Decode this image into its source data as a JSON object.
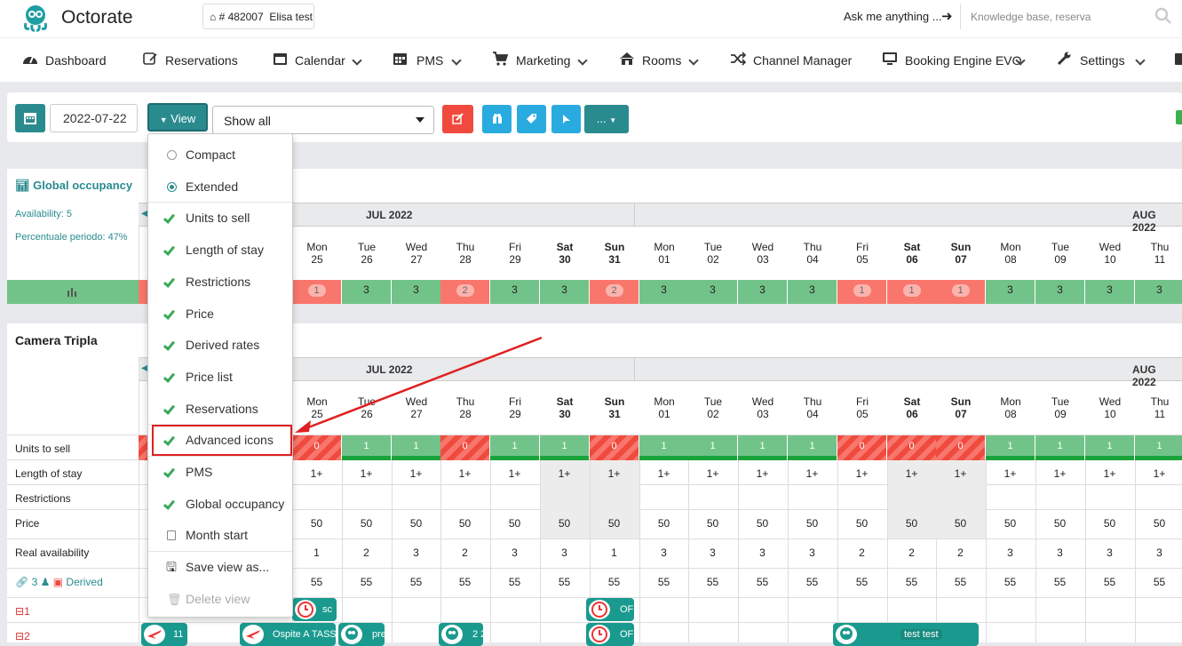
{
  "header": {
    "app_name": "Octorate",
    "property_id": "# 482007",
    "property_name": "Elisa test",
    "ask_label": "Ask me anything ...",
    "search_placeholder": "Knowledge base, reserva"
  },
  "nav": [
    {
      "label": "Dashboard",
      "icon": "dashboard-icon"
    },
    {
      "label": "Reservations",
      "icon": "reservations-icon"
    },
    {
      "label": "Calendar",
      "icon": "calendar-icon",
      "dropdown": true
    },
    {
      "label": "PMS",
      "icon": "pms-icon",
      "dropdown": true
    },
    {
      "label": "Marketing",
      "icon": "cart-icon",
      "dropdown": true
    },
    {
      "label": "Rooms",
      "icon": "home-icon",
      "dropdown": true
    },
    {
      "label": "Channel Manager",
      "icon": "shuffle-icon"
    },
    {
      "label": "Booking Engine EVO",
      "icon": "monitor-icon",
      "dropdown": true
    },
    {
      "label": "Settings",
      "icon": "wrench-icon",
      "dropdown": true
    }
  ],
  "toolbar": {
    "date": "2022-07-22",
    "view_label": "View",
    "filter_value": "Show all",
    "more_label": "..."
  },
  "view_menu": [
    {
      "label": "Compact",
      "type": "radio",
      "checked": false
    },
    {
      "label": "Extended",
      "type": "radio",
      "checked": true
    },
    {
      "label": "Units to sell",
      "type": "check",
      "checked": true
    },
    {
      "label": "Length of stay",
      "type": "check",
      "checked": true
    },
    {
      "label": "Restrictions",
      "type": "check",
      "checked": true
    },
    {
      "label": "Price",
      "type": "check",
      "checked": true
    },
    {
      "label": "Derived rates",
      "type": "check",
      "checked": true
    },
    {
      "label": "Price list",
      "type": "check",
      "checked": true
    },
    {
      "label": "Reservations",
      "type": "check",
      "checked": true
    },
    {
      "label": "Advanced icons",
      "type": "check",
      "checked": true,
      "highlighted": true
    },
    {
      "label": "PMS",
      "type": "check",
      "checked": true
    },
    {
      "label": "Global occupancy",
      "type": "check",
      "checked": true
    },
    {
      "label": "Month start",
      "type": "box",
      "checked": false
    },
    {
      "label": "Save view as...",
      "type": "save"
    },
    {
      "label": "Delete view",
      "type": "trash",
      "disabled": true
    }
  ],
  "global": {
    "title": "Global occupancy",
    "availability": "Availability: 5",
    "percent": "Percentuale periodo: 47%"
  },
  "months": {
    "jul": "JUL 2022",
    "aug": "AUG 2022"
  },
  "days": [
    {
      "dow": "Mon",
      "num": "25",
      "we": false
    },
    {
      "dow": "Tue",
      "num": "26",
      "we": false
    },
    {
      "dow": "Wed",
      "num": "27",
      "we": false
    },
    {
      "dow": "Thu",
      "num": "28",
      "we": false
    },
    {
      "dow": "Fri",
      "num": "29",
      "we": false
    },
    {
      "dow": "Sat",
      "num": "30",
      "we": true
    },
    {
      "dow": "Sun",
      "num": "31",
      "we": true
    },
    {
      "dow": "Mon",
      "num": "01",
      "we": false
    },
    {
      "dow": "Tue",
      "num": "02",
      "we": false
    },
    {
      "dow": "Wed",
      "num": "03",
      "we": false
    },
    {
      "dow": "Thu",
      "num": "04",
      "we": false
    },
    {
      "dow": "Fri",
      "num": "05",
      "we": false
    },
    {
      "dow": "Sat",
      "num": "06",
      "we": true
    },
    {
      "dow": "Sun",
      "num": "07",
      "we": true
    },
    {
      "dow": "Mon",
      "num": "08",
      "we": false
    },
    {
      "dow": "Tue",
      "num": "09",
      "we": false
    },
    {
      "dow": "Wed",
      "num": "10",
      "we": false
    },
    {
      "dow": "Thu",
      "num": "11",
      "we": false
    }
  ],
  "occupancy": [
    "1",
    "3",
    "3",
    "2",
    "3",
    "3",
    "2",
    "3",
    "3",
    "3",
    "3",
    "1",
    "1",
    "1",
    "3",
    "3",
    "3",
    "3"
  ],
  "occupancy_low": [
    true,
    false,
    false,
    true,
    false,
    false,
    true,
    false,
    false,
    false,
    false,
    true,
    true,
    true,
    false,
    false,
    false,
    false
  ],
  "room": {
    "name": "Camera Tripla",
    "rows": {
      "units": "Units to sell",
      "los": "Length of stay",
      "restr": "Restrictions",
      "price": "Price",
      "real": "Real availability",
      "derived_count": "3",
      "derived": "Derived"
    },
    "units": [
      "0",
      "1",
      "1",
      "0",
      "1",
      "1",
      "0",
      "1",
      "1",
      "1",
      "1",
      "0",
      "0",
      "0",
      "1",
      "1",
      "1",
      "1"
    ],
    "los": [
      "1+",
      "1+",
      "1+",
      "1+",
      "1+",
      "1+",
      "1+",
      "1+",
      "1+",
      "1+",
      "1+",
      "1+",
      "1+",
      "1+",
      "1+",
      "1+",
      "1+",
      "1+"
    ],
    "price": [
      "50",
      "50",
      "50",
      "50",
      "50",
      "50",
      "50",
      "50",
      "50",
      "50",
      "50",
      "50",
      "50",
      "50",
      "50",
      "50",
      "50",
      "50"
    ],
    "real": [
      "1",
      "2",
      "3",
      "2",
      "3",
      "3",
      "1",
      "3",
      "3",
      "3",
      "3",
      "2",
      "2",
      "2",
      "3",
      "3",
      "3",
      "3"
    ],
    "derived_vals": [
      "55",
      "55",
      "55",
      "55",
      "55",
      "55",
      "55",
      "55",
      "55",
      "55",
      "55",
      "55",
      "55",
      "55",
      "55",
      "55",
      "55",
      "55"
    ],
    "unit1": "1",
    "unit2": "2"
  },
  "bookings": {
    "b1": "sc",
    "b2": "OF",
    "b3": "11",
    "b4": "Ospite A TASSA",
    "b5": "pre",
    "b6": "2 2",
    "b7": "OF",
    "b8": "test test"
  },
  "colors": {
    "teal": "#2a8b8f",
    "red": "#f04a3e",
    "green": "#72c389",
    "cyan": "#29abe0"
  }
}
